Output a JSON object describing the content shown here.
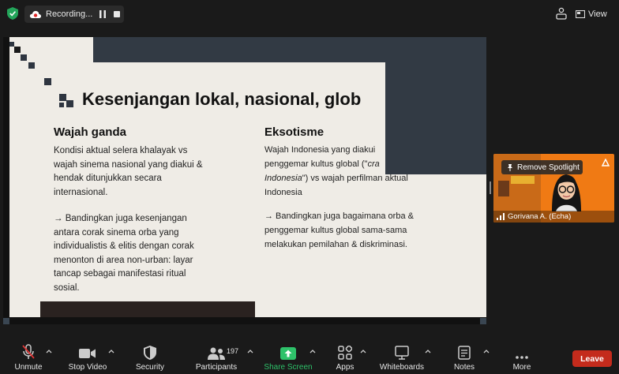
{
  "topbar": {
    "recording_label": "Recording...",
    "view_label": "View"
  },
  "slide": {
    "title": "Kesenjangan lokal, nasional, glob",
    "left_heading": "Wajah ganda",
    "left_para1": "Kondisi aktual selera khalayak vs\nwajah sinema nasional yang diakui &\nhendak ditunjukkan secara\ninternasional.",
    "left_para2": "→ Bandingkan juga kesenjangan\nantara corak sinema orba yang\nindividualistis & elitis dengan corak\nmenonton di area non-urban: layar\ntancap sebagai manifestasi ritual\nsosial.",
    "right_heading": "Eksotisme",
    "right_para1_line1": "Wajah Indonesia yang diakui",
    "right_para1_line2_pre": "penggemar kultus global (\"",
    "right_para1_line2_italic": "cra",
    "right_para1_line3_italic": "Indonesia",
    "right_para1_line3_post": "\") vs wajah perfilman aktual",
    "right_para1_line4": "Indonesia",
    "right_para2": "→ Bandingkan juga bagaimana orba &\npenggemar kultus global sama-sama\nmelakukan pemilahan & diskriminasi."
  },
  "participant_tile": {
    "remove_spotlight_label": "Remove Spotlight",
    "name": "Gorivana A. (Echa)"
  },
  "toolbar": {
    "unmute": "Unmute",
    "stop_video": "Stop Video",
    "security": "Security",
    "participants": "Participants",
    "participants_count": "197",
    "share_screen": "Share Screen",
    "apps": "Apps",
    "whiteboards": "Whiteboards",
    "notes": "Notes",
    "more": "More",
    "leave": "Leave"
  },
  "colors": {
    "share_green": "#2ec26a",
    "leave_red": "#c42b1c",
    "slide_dark": "#323a44",
    "slide_bg": "#efece6"
  }
}
